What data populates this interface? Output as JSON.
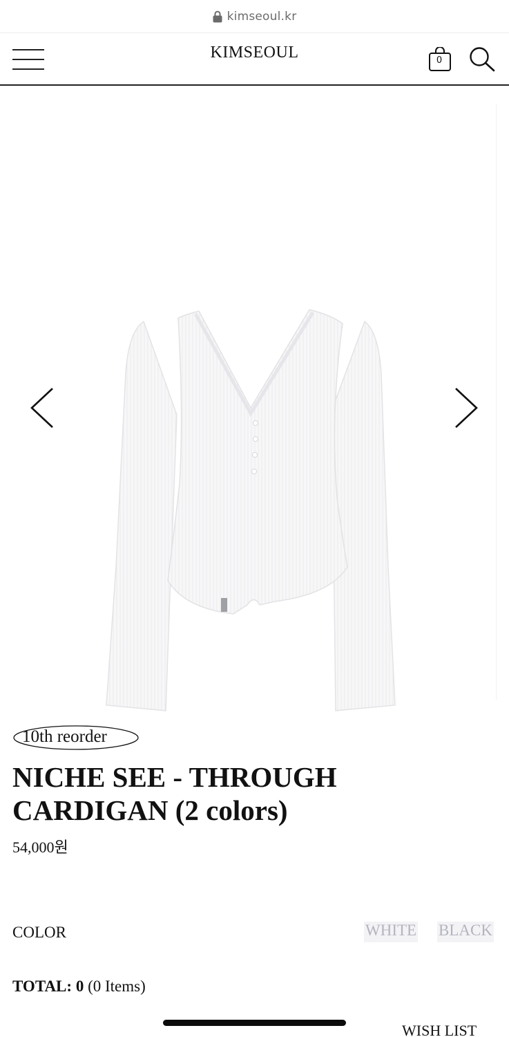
{
  "browser": {
    "url": "kimseoul.kr"
  },
  "header": {
    "logo": "KIMSEOUL",
    "cart_count": "0"
  },
  "product": {
    "badge": "10th reorder",
    "title": "NICHE SEE - THROUGH CARDIGAN (2 colors)",
    "price": "54,000원",
    "color_label": "COLOR",
    "colors": [
      "WHITE",
      "BLACK"
    ],
    "total_label": "TOTAL:",
    "total_value": "0",
    "total_items": "(0 Items)"
  },
  "footer": {
    "wish_list": "WISH LIST"
  },
  "icons": {
    "lock": "lock-icon",
    "menu": "hamburger-icon",
    "cart": "shopping-bag-icon",
    "search": "search-icon",
    "prev": "chevron-left-icon",
    "next": "chevron-right-icon"
  },
  "colors": {
    "option_bg": "#f3f3f6",
    "option_text": "#b4b4bf",
    "text": "#111111"
  }
}
